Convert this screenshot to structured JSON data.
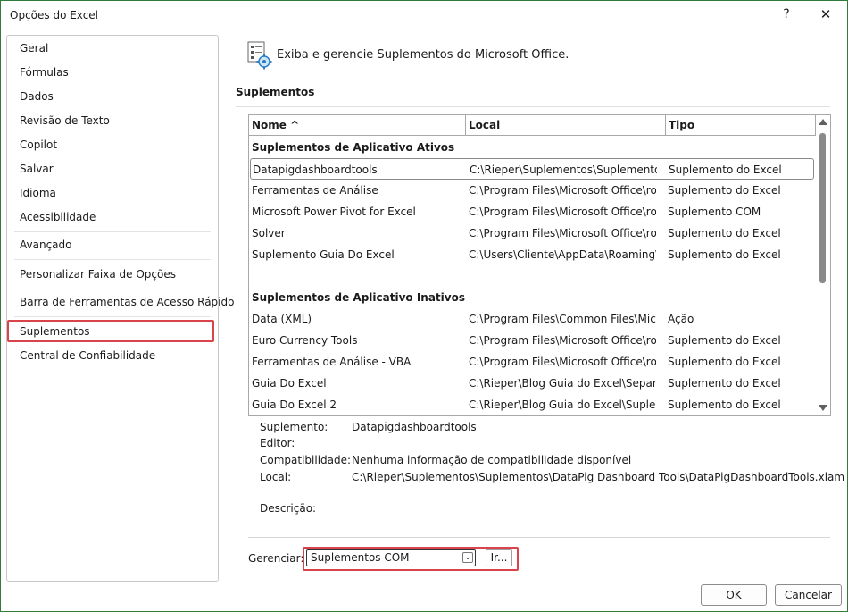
{
  "window": {
    "title": "Opções do Excel",
    "help_glyph": "?",
    "close_glyph": "✕"
  },
  "nav": {
    "items": [
      {
        "label": "Geral"
      },
      {
        "label": "Fórmulas"
      },
      {
        "label": "Dados"
      },
      {
        "label": "Revisão de Texto"
      },
      {
        "label": "Copilot"
      },
      {
        "label": "Salvar"
      },
      {
        "label": "Idioma"
      },
      {
        "label": "Acessibilidade"
      },
      {
        "label": "Avançado"
      },
      {
        "label": "Personalizar Faixa de Opções"
      },
      {
        "label": "Barra de Ferramentas de Acesso Rápido"
      },
      {
        "label": "Suplementos",
        "selected": true
      },
      {
        "label": "Central de Confiabilidade"
      }
    ]
  },
  "header": {
    "text": "Exiba e gerencie Suplementos do Microsoft Office.",
    "icon": "addins-gear-icon"
  },
  "section": {
    "title": "Suplementos"
  },
  "table": {
    "columns": [
      "Nome ^",
      "Local",
      "Tipo"
    ],
    "groups": [
      {
        "title": "Suplementos de Aplicativo Ativos",
        "rows": [
          [
            "Datapigdashboardtools",
            "C:\\Rieper\\Suplementos\\Suplementos\\",
            "Suplemento do Excel"
          ],
          [
            "Ferramentas de Análise",
            "C:\\Program Files\\Microsoft Office\\root",
            "Suplemento do Excel"
          ],
          [
            "Microsoft Power Pivot for Excel",
            "C:\\Program Files\\Microsoft Office\\root",
            "Suplemento COM"
          ],
          [
            "Solver",
            "C:\\Program Files\\Microsoft Office\\root",
            "Suplemento do Excel"
          ],
          [
            "Suplemento Guia Do Excel",
            "C:\\Users\\Cliente\\AppData\\Roaming\\M",
            "Suplemento do Excel"
          ]
        ]
      },
      {
        "title": "Suplementos de Aplicativo Inativos",
        "rows": [
          [
            "Data (XML)",
            "C:\\Program Files\\Common Files\\Micro",
            "Ação"
          ],
          [
            "Euro Currency Tools",
            "C:\\Program Files\\Microsoft Office\\root",
            "Suplemento do Excel"
          ],
          [
            "Ferramentas de Análise - VBA",
            "C:\\Program Files\\Microsoft Office\\root",
            "Suplemento do Excel"
          ],
          [
            "Guia Do Excel",
            "C:\\Rieper\\Blog Guia do Excel\\Separar D",
            "Suplemento do Excel"
          ],
          [
            "Guia Do Excel 2",
            "C:\\Rieper\\Blog Guia do Excel\\Supleme",
            "Suplemento do Excel"
          ]
        ]
      }
    ]
  },
  "details": {
    "suplemento_label": "Suplemento:",
    "suplemento_value": "Datapigdashboardtools",
    "editor_label": "Editor:",
    "editor_value": "",
    "compat_label": "Compatibilidade:",
    "compat_value": "Nenhuma informação de compatibilidade disponível",
    "local_label": "Local:",
    "local_value": "C:\\Rieper\\Suplementos\\Suplementos\\DataPig Dashboard Tools\\DataPigDashboardTools.xlam",
    "descricao_label": "Descrição:",
    "descricao_value": ""
  },
  "manage": {
    "label": "Gerenciar:",
    "selected": "Suplementos COM",
    "go_button": "Ir..."
  },
  "buttons": {
    "ok": "OK",
    "cancel": "Cancelar"
  },
  "colors": {
    "window_border": "#2f7d3a",
    "highlight": "#d9434b"
  }
}
